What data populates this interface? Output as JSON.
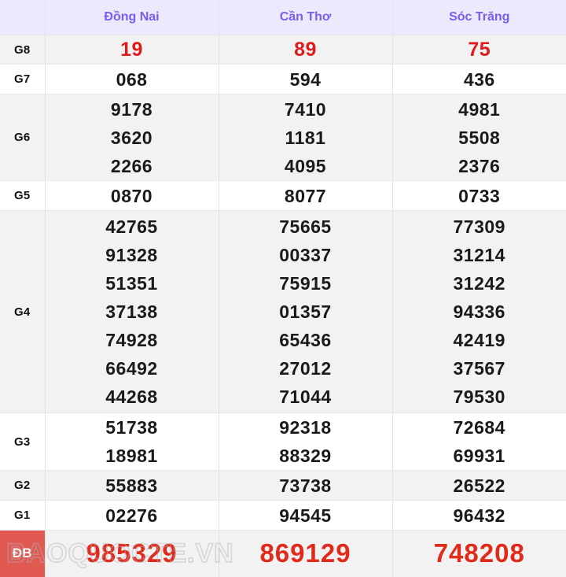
{
  "table": {
    "corner_label": "",
    "columns": [
      "Đồng Nai",
      "Cần Thơ",
      "Sóc Trăng"
    ],
    "rows": [
      {
        "label": "G8",
        "style": "red-small",
        "values": [
          [
            "19"
          ],
          [
            "89"
          ],
          [
            "75"
          ]
        ]
      },
      {
        "label": "G7",
        "style": "normal",
        "values": [
          [
            "068"
          ],
          [
            "594"
          ],
          [
            "436"
          ]
        ]
      },
      {
        "label": "G6",
        "style": "normal",
        "values": [
          [
            "9178",
            "3620",
            "2266"
          ],
          [
            "7410",
            "1181",
            "4095"
          ],
          [
            "4981",
            "5508",
            "2376"
          ]
        ]
      },
      {
        "label": "G5",
        "style": "normal",
        "values": [
          [
            "0870"
          ],
          [
            "8077"
          ],
          [
            "0733"
          ]
        ]
      },
      {
        "label": "G4",
        "style": "normal",
        "values": [
          [
            "42765",
            "91328",
            "51351",
            "37138",
            "74928",
            "66492",
            "44268"
          ],
          [
            "75665",
            "00337",
            "75915",
            "01357",
            "65436",
            "27012",
            "71044"
          ],
          [
            "77309",
            "31214",
            "31242",
            "94336",
            "42419",
            "37567",
            "79530"
          ]
        ]
      },
      {
        "label": "G3",
        "style": "normal",
        "values": [
          [
            "51738",
            "18981"
          ],
          [
            "92318",
            "88329"
          ],
          [
            "72684",
            "69931"
          ]
        ]
      },
      {
        "label": "G2",
        "style": "normal",
        "values": [
          [
            "55883"
          ],
          [
            "73738"
          ],
          [
            "26522"
          ]
        ]
      },
      {
        "label": "G1",
        "style": "normal",
        "values": [
          [
            "02276"
          ],
          [
            "94545"
          ],
          [
            "96432"
          ]
        ]
      },
      {
        "label": "ĐB",
        "style": "special",
        "values": [
          [
            "985329"
          ],
          [
            "869129"
          ],
          [
            "748208"
          ]
        ]
      }
    ]
  },
  "watermark": {
    "text": "BAOQUOCTE.VN"
  },
  "colors": {
    "header_bg": "#ebe9fb",
    "header_text": "#7a5cf0",
    "shade_row_bg": "#f2f2f2",
    "plain_row_bg": "#ffffff",
    "g8_number": "#e01b1b",
    "special_badge_bg": "#e05a52",
    "special_number": "#e02b1b",
    "number_text": "#1a1a1a",
    "border": "#e2e2e6"
  }
}
